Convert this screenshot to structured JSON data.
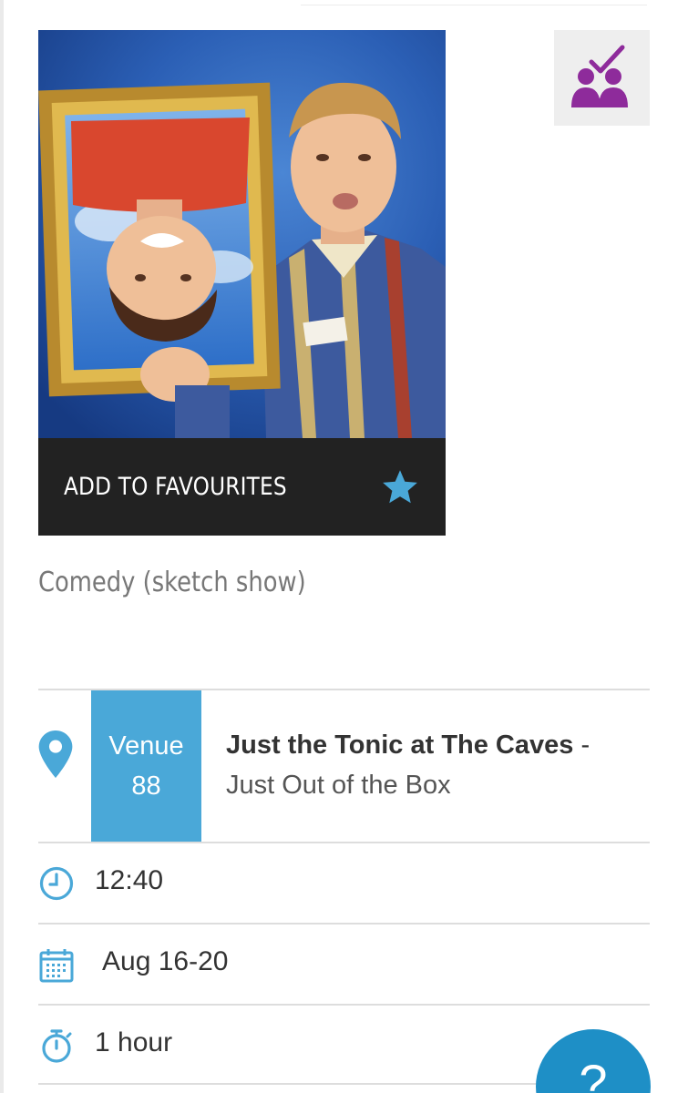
{
  "favourites": {
    "label": "ADD TO FAVOURITES",
    "icon": "star-icon",
    "accent": "#4aa8d8"
  },
  "accessibility": {
    "icon": "relaxed-performance-icon",
    "color": "#8e2b9b"
  },
  "genre": "Comedy (sketch show)",
  "venue": {
    "label": "Venue",
    "number": "88",
    "name": "Just the Tonic at The Caves",
    "separator": " -",
    "room": "Just Out of the Box",
    "icon": "map-pin-icon"
  },
  "time": {
    "value": "12:40",
    "icon": "clock-icon"
  },
  "dates": {
    "value": "Aug 16-20",
    "icon": "calendar-icon"
  },
  "duration": {
    "value": "1 hour",
    "icon": "stopwatch-icon"
  },
  "help": {
    "label": "?"
  },
  "colors": {
    "accent": "#4aa8d8",
    "help": "#1e8fc6",
    "dark_bar": "#222222"
  }
}
